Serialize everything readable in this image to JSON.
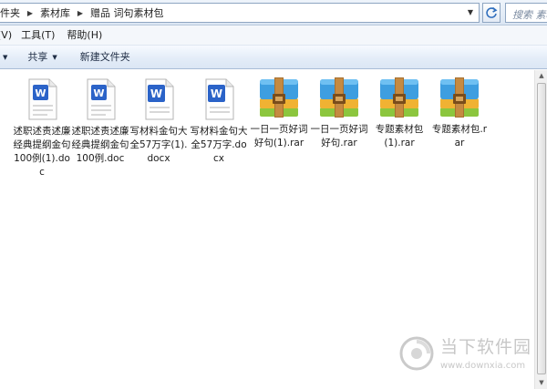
{
  "address_bar": {
    "crumbs": [
      "件夹",
      "素材库",
      "赠品 词句素材包"
    ]
  },
  "search": {
    "placeholder": "搜索 素材包"
  },
  "menu": {
    "items": [
      "(V)",
      "工具(T)",
      "帮助(H)"
    ]
  },
  "toolbar": {
    "share_label": "共享",
    "new_folder_label": "新建文件夹"
  },
  "files": [
    {
      "name": "述职述责述廉经典提纲金句100例(1).doc",
      "type": "word",
      "icon": "word-doc-icon"
    },
    {
      "name": "述职述责述廉经典提纲金句100例.doc",
      "type": "word",
      "icon": "word-doc-icon"
    },
    {
      "name": "写材料金句大全57万字(1).docx",
      "type": "word",
      "icon": "word-docx-icon"
    },
    {
      "name": "写材料金句大全57万字.docx",
      "type": "word",
      "icon": "word-docx-icon"
    },
    {
      "name": "一日一页好词好句(1).rar",
      "type": "rar",
      "icon": "rar-archive-icon"
    },
    {
      "name": "一日一页好词好句.rar",
      "type": "rar",
      "icon": "rar-archive-icon"
    },
    {
      "name": "专题素材包(1).rar",
      "type": "rar",
      "icon": "rar-archive-icon"
    },
    {
      "name": "专题素材包.rar",
      "type": "rar",
      "icon": "rar-archive-icon"
    }
  ],
  "watermark": {
    "brand": "当下软件园",
    "url": "www.downxia.com"
  },
  "colors": {
    "word_blue": "#2b63c8",
    "rar_blue": "#3e9ee0",
    "rar_strap": "#a8702f",
    "toolbar_bg": "#e4edf8"
  }
}
